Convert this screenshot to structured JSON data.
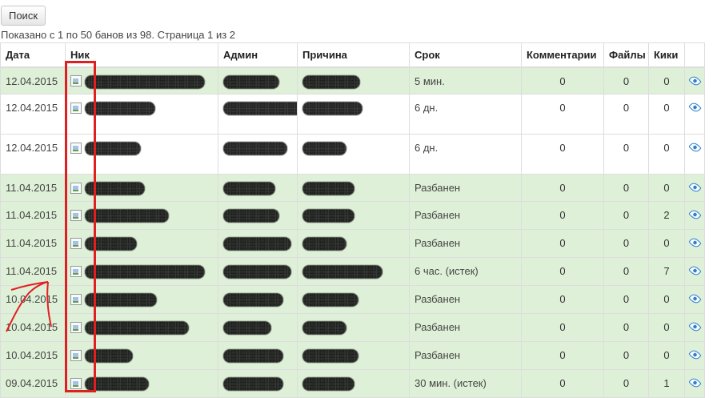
{
  "toolbar": {
    "search_label": "Поиск"
  },
  "summary": "Показано с 1 по 50 банов из 98. Страница 1 из 2",
  "table": {
    "headers": [
      "Дата",
      "Ник",
      "Админ",
      "Причина",
      "Срок",
      "Комментарии",
      "Файлы",
      "Кики"
    ],
    "rows": [
      {
        "date": "12.04.2015",
        "term": "5 мин.",
        "comments": "0",
        "files": "0",
        "kicks": "0",
        "status": "banned"
      },
      {
        "date": "12.04.2015",
        "term": "6 дн.",
        "comments": "0",
        "files": "0",
        "kicks": "0",
        "status": "active"
      },
      {
        "date": "12.04.2015",
        "term": "6 дн.",
        "comments": "0",
        "files": "0",
        "kicks": "0",
        "status": "active"
      },
      {
        "date": "11.04.2015",
        "term": "Разбанен",
        "comments": "0",
        "files": "0",
        "kicks": "0",
        "status": "banned"
      },
      {
        "date": "11.04.2015",
        "term": "Разбанен",
        "comments": "0",
        "files": "0",
        "kicks": "2",
        "status": "banned"
      },
      {
        "date": "11.04.2015",
        "term": "Разбанен",
        "comments": "0",
        "files": "0",
        "kicks": "0",
        "status": "banned"
      },
      {
        "date": "11.04.2015",
        "term": "6 час. (истек)",
        "comments": "0",
        "files": "0",
        "kicks": "7",
        "status": "banned"
      },
      {
        "date": "10.04.2015",
        "term": "Разбанен",
        "comments": "0",
        "files": "0",
        "kicks": "0",
        "status": "banned"
      },
      {
        "date": "10.04.2015",
        "term": "Разбанен",
        "comments": "0",
        "files": "0",
        "kicks": "0",
        "status": "banned"
      },
      {
        "date": "10.04.2015",
        "term": "Разбанен",
        "comments": "0",
        "files": "0",
        "kicks": "0",
        "status": "banned"
      },
      {
        "date": "09.04.2015",
        "term": "30 мин. (истек)",
        "comments": "0",
        "files": "0",
        "kicks": "1",
        "status": "banned"
      }
    ]
  },
  "colors": {
    "banned_row": "#dff0d8",
    "active_row": "#ffffff",
    "annotation": "#e02020",
    "eye_icon": "#2a7fd0"
  },
  "icons": {
    "avatar": "broken-image-icon",
    "details": "eye-icon"
  }
}
